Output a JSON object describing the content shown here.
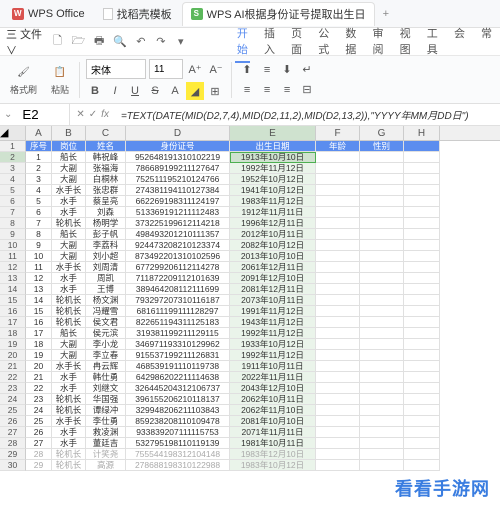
{
  "tabs": {
    "t1": "WPS Office",
    "t2": "找稻壳模板",
    "t3": "WPS AI根据身份证号提取出生日"
  },
  "menu": {
    "file": "三 文件 ∨"
  },
  "quick": {
    "save": "💾",
    "redo": "↷",
    "undo": "↶",
    "print": "🖶",
    "dropdown": "▾"
  },
  "ribbonTabs": {
    "start": "开始",
    "insert": "插入",
    "layout": "页面",
    "formula": "公式",
    "data": "数据",
    "review": "审阅",
    "view": "视图",
    "tools": "工具",
    "member": "会",
    "extra": "常"
  },
  "ribbon": {
    "format": "格式刷",
    "paste": "粘贴",
    "fontName": "宋体",
    "fontSize": "11",
    "bold": "B",
    "italic": "I",
    "underline": "U",
    "strike": "S",
    "fontA": "A",
    "fontA2": "A"
  },
  "nameBox": "E2",
  "formula": "=TEXT(DATE(MID(D2,7,4),MID(D2,11,2),MID(D2,13,2)),\"YYYY年MM月DD日\")",
  "cols": {
    "A": "A",
    "B": "B",
    "C": "C",
    "D": "D",
    "E": "E",
    "F": "F",
    "G": "G",
    "H": "H"
  },
  "headers": {
    "seq": "序号",
    "pos": "岗位",
    "name": "姓名",
    "id": "身份证号",
    "birth": "出生日期",
    "age": "年龄",
    "gender": "性别"
  },
  "rows": [
    {
      "r": 2,
      "n": 1,
      "pos": "船长",
      "name": "韩祝峰",
      "id": "952648191310102219",
      "birth": "1913年10月10日"
    },
    {
      "r": 3,
      "n": 2,
      "pos": "大副",
      "name": "张福海",
      "id": "786689199211127647",
      "birth": "1992年11月12日"
    },
    {
      "r": 4,
      "n": 3,
      "pos": "大副",
      "name": "白桐林",
      "id": "752511195210124766",
      "birth": "1952年10月12日"
    },
    {
      "r": 5,
      "n": 4,
      "pos": "水手长",
      "name": "张忠群",
      "id": "274381194110127384",
      "birth": "1941年10月12日"
    },
    {
      "r": 6,
      "n": 5,
      "pos": "水手",
      "name": "蔡呈亮",
      "id": "662269198311124197",
      "birth": "1983年11月12日"
    },
    {
      "r": 7,
      "n": 6,
      "pos": "水手",
      "name": "刘森",
      "id": "513369191211112483",
      "birth": "1912年11月11日"
    },
    {
      "r": 8,
      "n": 7,
      "pos": "轮机长",
      "name": "杨明学",
      "id": "373225199612114218",
      "birth": "1996年12月11日"
    },
    {
      "r": 9,
      "n": 8,
      "pos": "船长",
      "name": "彭子帆",
      "id": "498493201210111357",
      "birth": "2012年10月11日"
    },
    {
      "r": 10,
      "n": 9,
      "pos": "大副",
      "name": "李荔科",
      "id": "924473208210123374",
      "birth": "2082年10月12日"
    },
    {
      "r": 11,
      "n": 10,
      "pos": "大副",
      "name": "刘小超",
      "id": "873492201310102596",
      "birth": "2013年10月10日"
    },
    {
      "r": 12,
      "n": 11,
      "pos": "水手长",
      "name": "刘周清",
      "id": "677299206112114278",
      "birth": "2061年12月11日"
    },
    {
      "r": 13,
      "n": 12,
      "pos": "水手",
      "name": "周凯",
      "id": "711872209112101639",
      "birth": "2091年12月10日"
    },
    {
      "r": 14,
      "n": 13,
      "pos": "水手",
      "name": "王博",
      "id": "389464208112111699",
      "birth": "2081年12月11日"
    },
    {
      "r": 15,
      "n": 14,
      "pos": "轮机长",
      "name": "杨文渊",
      "id": "793297207310116187",
      "birth": "2073年10月11日"
    },
    {
      "r": 16,
      "n": 15,
      "pos": "轮机长",
      "name": "冯耀雪",
      "id": "681611199111128297",
      "birth": "1991年11月12日"
    },
    {
      "r": 17,
      "n": 16,
      "pos": "轮机长",
      "name": "侯文君",
      "id": "822651194311125183",
      "birth": "1943年11月12日"
    },
    {
      "r": 18,
      "n": 17,
      "pos": "船长",
      "name": "侯元滨",
      "id": "319381199211129115",
      "birth": "1992年11月12日"
    },
    {
      "r": 19,
      "n": 18,
      "pos": "大副",
      "name": "李小龙",
      "id": "346971193310129962",
      "birth": "1933年10月12日"
    },
    {
      "r": 20,
      "n": 19,
      "pos": "大副",
      "name": "李立春",
      "id": "915537199211126831",
      "birth": "1992年11月12日"
    },
    {
      "r": 21,
      "n": 20,
      "pos": "水手长",
      "name": "冉云辉",
      "id": "468539191110119738",
      "birth": "1911年10月11日"
    },
    {
      "r": 22,
      "n": 21,
      "pos": "水手",
      "name": "韩仕勇",
      "id": "642986202211114638",
      "birth": "2022年11月11日"
    },
    {
      "r": 23,
      "n": 22,
      "pos": "水手",
      "name": "刘继文",
      "id": "326445204312106737",
      "birth": "2043年12月10日"
    },
    {
      "r": 24,
      "n": 23,
      "pos": "轮机长",
      "name": "华国强",
      "id": "396155206210118137",
      "birth": "2062年10月11日"
    },
    {
      "r": 25,
      "n": 24,
      "pos": "轮机长",
      "name": "谭绿冲",
      "id": "329948206211103843",
      "birth": "2062年11月10日"
    },
    {
      "r": 26,
      "n": 25,
      "pos": "水手长",
      "name": "李仕勇",
      "id": "859238208110109478",
      "birth": "2081年10月10日"
    },
    {
      "r": 27,
      "n": 26,
      "pos": "水手",
      "name": "救凌渊",
      "id": "933839207111115753",
      "birth": "2071年11月11日"
    },
    {
      "r": 28,
      "n": 27,
      "pos": "水手",
      "name": "董廷吉",
      "id": "532795198110119139",
      "birth": "1981年10月11日"
    },
    {
      "r": 29,
      "n": 28,
      "pos": "轮机长",
      "name": "计笑尧",
      "id": "755544198312104148",
      "birth": "1983年12月10日",
      "dim": true
    },
    {
      "r": 30,
      "n": 29,
      "pos": "轮机长",
      "name": "高源",
      "id": "278688198310122988",
      "birth": "1983年10月12日",
      "dim": true
    }
  ],
  "watermark": "看看手游网"
}
